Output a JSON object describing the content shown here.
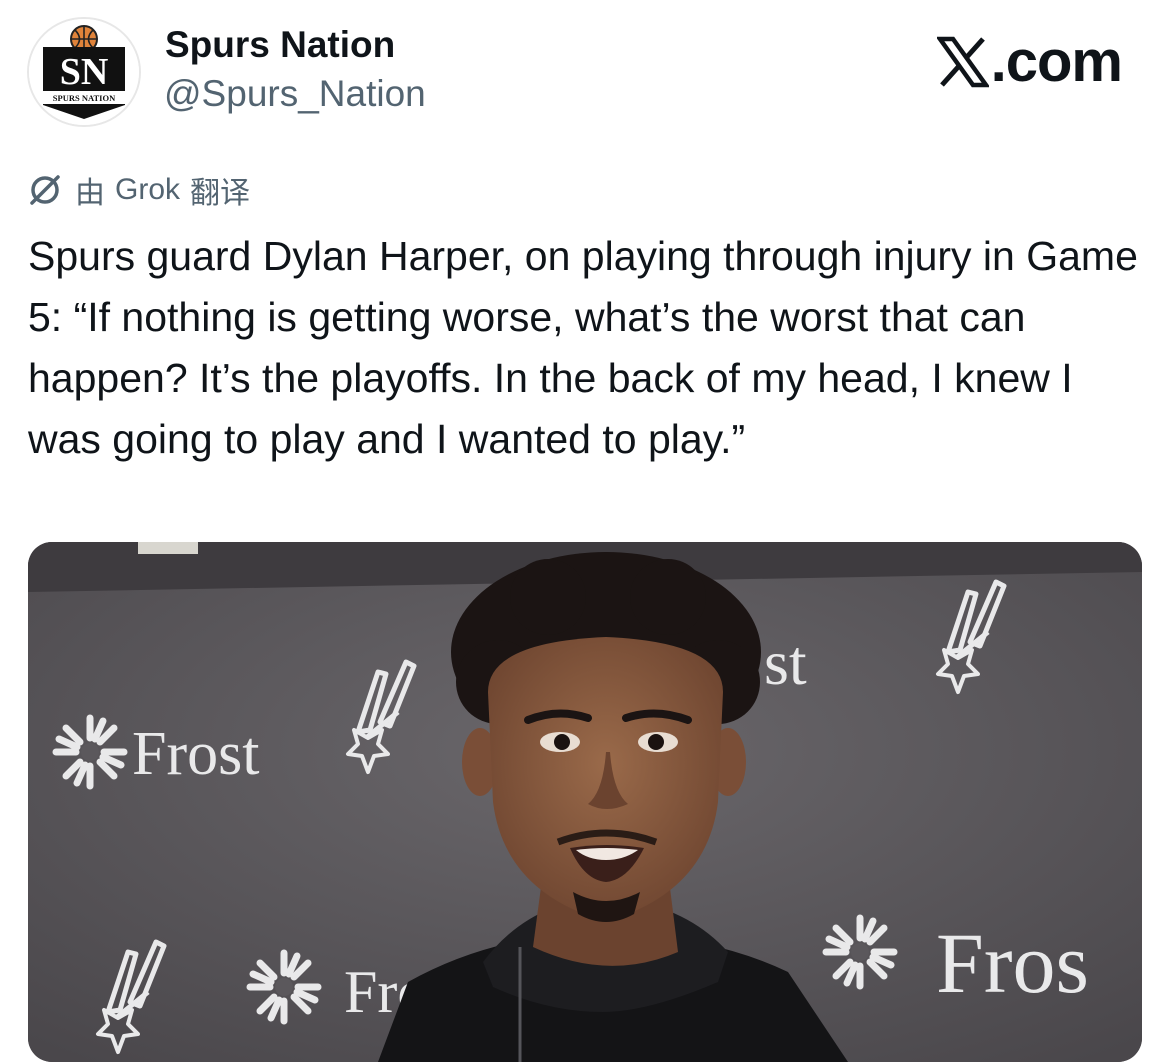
{
  "author": {
    "name": "Spurs Nation",
    "handle": "@Spurs_Nation",
    "avatar_initials": "SN",
    "avatar_subtitle": "SPURS NATION"
  },
  "source": {
    "label": ".com",
    "icon": "x-logo-icon"
  },
  "translation": {
    "prefix": "由",
    "provider": "Grok",
    "suffix": "翻译",
    "icon": "grok-icon"
  },
  "tweet": {
    "text": "Spurs guard Dylan Harper, on playing through injury in Game 5: “If nothing is getting worse, what’s the worst that can happen? It’s the playoffs. In the back of my head, I knew I was going to play and I wanted to play.”"
  },
  "media": {
    "backdrop_words": [
      "Frost",
      "st",
      "Fro",
      "Fros"
    ],
    "colors": {
      "backdrop": "#5b585c",
      "wall_text": "#e9e9ea",
      "skin": "#8a5a3e",
      "hair": "#1b1413",
      "hoodie": "#141416"
    }
  }
}
